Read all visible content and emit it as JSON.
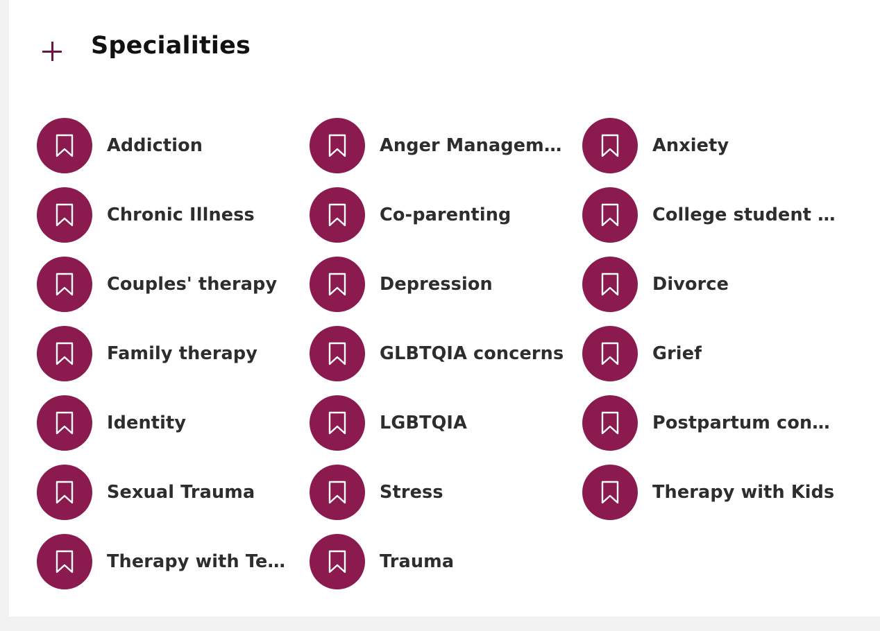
{
  "section": {
    "title": "Specialities"
  },
  "specialities": [
    "Addiction",
    "Anger Management",
    "Anxiety",
    "Chronic Illness",
    "Co-parenting",
    "College student counseling",
    "Couples' therapy",
    "Depression",
    "Divorce",
    "Family therapy",
    "GLBTQIA concerns",
    "Grief",
    "Identity",
    "LGBTQIA",
    "Postpartum concerns",
    "Sexual Trauma",
    "Stress",
    "Therapy with Kids",
    "Therapy with Teens",
    "Trauma"
  ],
  "colors": {
    "accent": "#8b1a4e",
    "plus": "#6e1445",
    "background": "#f2f2f2",
    "card": "#ffffff",
    "text": "#2d2d2d"
  },
  "icons": {
    "toggle": "plus-icon",
    "item": "bookmark-icon"
  }
}
